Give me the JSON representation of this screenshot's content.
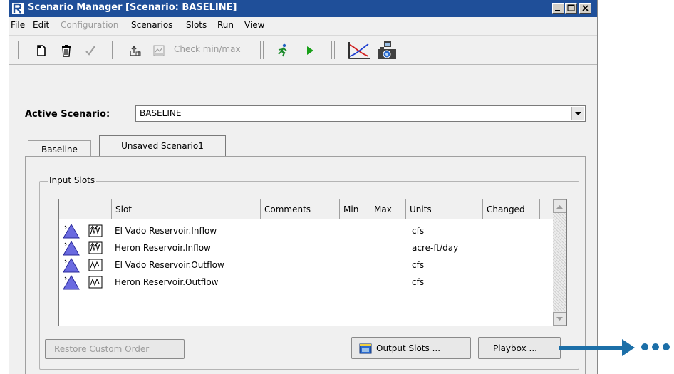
{
  "window": {
    "title": "Scenario Manager [Scenario: BASELINE]",
    "controls": [
      "minimize",
      "maximize",
      "close"
    ]
  },
  "menu": {
    "items": [
      {
        "label": "File",
        "enabled": true
      },
      {
        "label": "Edit",
        "enabled": true
      },
      {
        "label": "Configuration",
        "enabled": false
      },
      {
        "label": "Scenarios",
        "enabled": true
      },
      {
        "label": "Slots",
        "enabled": true
      },
      {
        "label": "Run",
        "enabled": true
      },
      {
        "label": "View",
        "enabled": true
      }
    ]
  },
  "toolbar": {
    "buttons": [
      "new-icon",
      "delete-icon",
      "check-icon",
      "export-icon",
      "plot-icon",
      "run-icon",
      "play-icon",
      "chart-icon",
      "camera-icon"
    ],
    "check_minmax_label": "Check min/max"
  },
  "active_scenario": {
    "label": "Active Scenario:",
    "value": "BASELINE"
  },
  "tabs": [
    {
      "label": "Baseline",
      "selected": false
    },
    {
      "label": "Unsaved Scenario1",
      "selected": true
    }
  ],
  "input_slots": {
    "group_label": "Input Slots",
    "columns": [
      "Slot",
      "Comments",
      "Min",
      "Max",
      "Units",
      "Changed"
    ],
    "rows": [
      {
        "slot": "El Vado Reservoir.Inflow",
        "comments": "",
        "min": "",
        "max": "",
        "units": "cfs",
        "changed": "",
        "series_icon": "inflow-series-icon"
      },
      {
        "slot": "Heron Reservoir.Inflow",
        "comments": "",
        "min": "",
        "max": "",
        "units": "acre-ft/day",
        "changed": "",
        "series_icon": "inflow-series-icon"
      },
      {
        "slot": "El Vado Reservoir.Outflow",
        "comments": "",
        "min": "",
        "max": "",
        "units": "cfs",
        "changed": "",
        "series_icon": "outflow-series-icon"
      },
      {
        "slot": "Heron Reservoir.Outflow",
        "comments": "",
        "min": "",
        "max": "",
        "units": "cfs",
        "changed": "",
        "series_icon": "outflow-series-icon"
      }
    ]
  },
  "buttons": {
    "restore_custom_order": "Restore Custom Order",
    "output_slots": "Output Slots ...",
    "playbox": "Playbox ..."
  },
  "colors": {
    "titlebar": "#1f4f99",
    "callout_arrow": "#1c6fa8",
    "reservoir_icon": "#6a6ae0"
  }
}
